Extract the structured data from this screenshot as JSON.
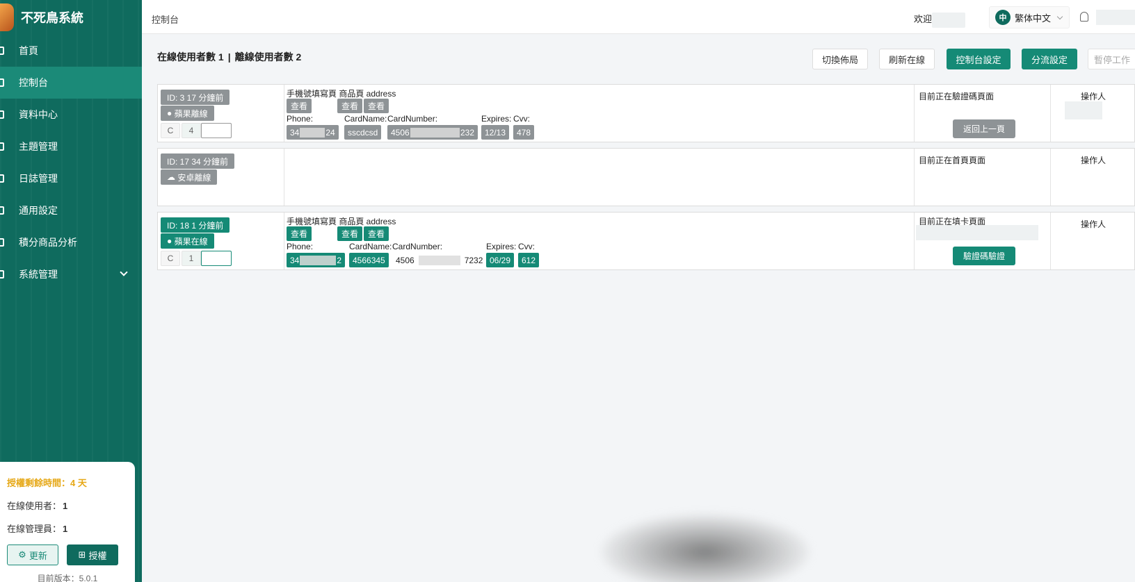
{
  "brand": {
    "title": "不死鳥系統"
  },
  "sidebar": {
    "items": [
      {
        "label": "首頁",
        "icon": "home-icon"
      },
      {
        "label": "控制台",
        "icon": "console-icon",
        "active": true
      },
      {
        "label": "資料中心",
        "icon": "data-icon"
      },
      {
        "label": "主題管理",
        "icon": "theme-icon"
      },
      {
        "label": "日誌管理",
        "icon": "log-icon"
      },
      {
        "label": "通用設定",
        "icon": "settings-icon"
      },
      {
        "label": "積分商品分析",
        "icon": "chart-icon"
      },
      {
        "label": "系統管理",
        "icon": "system-icon"
      }
    ]
  },
  "auth": {
    "remaining": "授權剩餘時間：4 天",
    "online_users_label": "在線使用者：",
    "online_users": "1",
    "online_admins_label": "在線管理員：",
    "online_admins": "1",
    "update_label": "更新",
    "auth_label": "授權",
    "version": "目前版本：5.0.1"
  },
  "header": {
    "breadcrumb": "控制台",
    "welcome": "欢迎",
    "lang_badge": "中",
    "lang": "繁体中文"
  },
  "stats": {
    "online": "在線使用者數 1",
    "sep": "|",
    "offline": "離線使用者數 2"
  },
  "toolbar": {
    "switch_layout": "切換佈局",
    "refresh_online": "刷新在線",
    "console_settings": "控制台設定",
    "split_settings": "分流設定",
    "pause_work": "暫停工作"
  },
  "rows": [
    {
      "id_tag": "ID: 3  17 分鐘前",
      "device": "蘋果離線",
      "c": "C",
      "count": "4",
      "pages": "手機號填寫頁 商品頁 address",
      "view": "查看",
      "phone_label": "Phone:",
      "cardname_label": "CardName:",
      "cardnumber_label": "CardNumber:",
      "expires_label": "Expires:",
      "cvv_label": "Cvv:",
      "phone_a": "34",
      "phone_b": "24",
      "cardname": "sscdcsd",
      "card_a": "4506",
      "card_b": "232",
      "expires": "12/13",
      "cvv": "478",
      "status": "目前正在驗證碼頁面",
      "action": "返回上一頁",
      "operator": "操作人"
    },
    {
      "id_tag": "ID: 17  34 分鐘前",
      "device": "安卓離線",
      "status": "目前正在首頁頁面",
      "operator": "操作人"
    },
    {
      "id_tag": "ID: 18  1 分鐘前",
      "device": "蘋果在線",
      "c": "C",
      "count": "1",
      "pages": "手機號填寫頁 商品頁 address",
      "view": "查看",
      "phone_label": "Phone:",
      "cardname_label": "CardName:",
      "cardnumber_label": "CardNumber:",
      "expires_label": "Expires:",
      "cvv_label": "Cvv:",
      "phone_a": "34",
      "phone_b": "2",
      "cardname": "4566345",
      "card_a": "4506",
      "card_b": "7232",
      "expires": "06/29",
      "cvv": "612",
      "status": "目前正在填卡頁面",
      "action": "驗證碼驗證",
      "operator": "操作人"
    }
  ]
}
